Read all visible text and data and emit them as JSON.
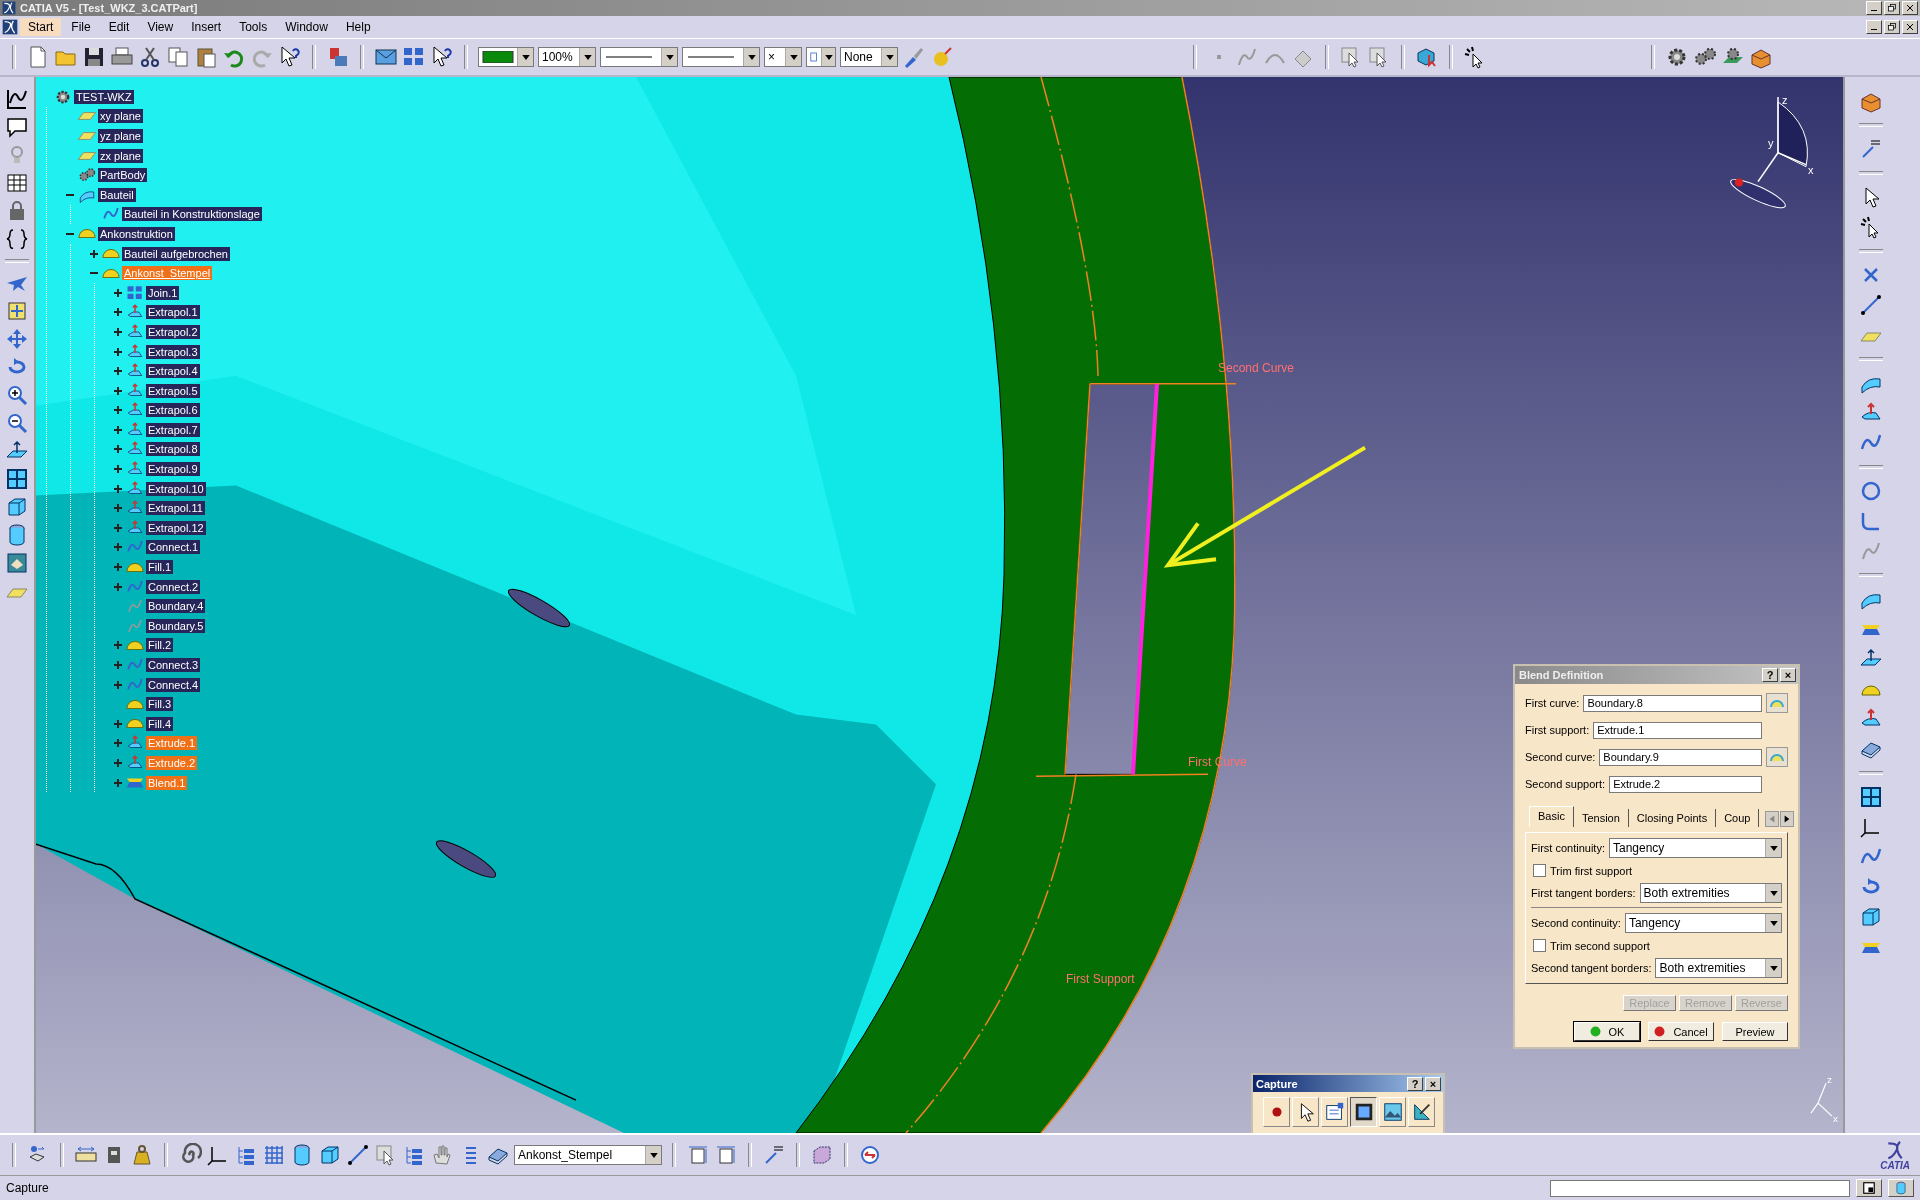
{
  "window": {
    "title": "CATIA V5 - [Test_WKZ_3.CATPart]"
  },
  "menu": [
    {
      "label": "Start",
      "selected": true
    },
    {
      "label": "File",
      "selected": false
    },
    {
      "label": "Edit",
      "selected": false
    },
    {
      "label": "View",
      "selected": false
    },
    {
      "label": "Insert",
      "selected": false
    },
    {
      "label": "Tools",
      "selected": false
    },
    {
      "label": "Window",
      "selected": false
    },
    {
      "label": "Help",
      "selected": false
    }
  ],
  "toolbar": {
    "zoom": "100%",
    "point_symbol": "×",
    "layer": "None"
  },
  "tree": {
    "nodes": [
      {
        "label": "TEST-WKZ",
        "kind": "part",
        "selected": false,
        "current": false,
        "children": [
          {
            "label": "xy plane",
            "kind": "plane",
            "selected": false,
            "current": false
          },
          {
            "label": "yz plane",
            "kind": "plane",
            "selected": false,
            "current": false
          },
          {
            "label": "zx plane",
            "kind": "plane",
            "selected": false,
            "current": false
          },
          {
            "label": "PartBody",
            "kind": "body",
            "selected": false,
            "current": false
          },
          {
            "label": "Bauteil",
            "kind": "geometric_set",
            "selected": false,
            "current": false,
            "expanded": true,
            "children": [
              {
                "label": "Bauteil in Konstruktionslage",
                "kind": "link",
                "selected": false,
                "current": false
              }
            ]
          },
          {
            "label": "Ankonstruktion",
            "kind": "ordered_set",
            "selected": false,
            "current": false,
            "expanded": true,
            "children": [
              {
                "label": "Bauteil aufgebrochen",
                "kind": "ordered_set",
                "selected": false,
                "current": false,
                "expanded": false
              },
              {
                "label": "Ankonst_Stempel",
                "kind": "ordered_set",
                "selected": true,
                "current": true,
                "expanded": true,
                "children": [
                  {
                    "label": "Join.1",
                    "kind": "join",
                    "selected": false,
                    "current": false,
                    "expanded": false
                  },
                  {
                    "label": "Extrapol.1",
                    "kind": "extrapol",
                    "selected": false,
                    "current": false,
                    "expanded": false
                  },
                  {
                    "label": "Extrapol.2",
                    "kind": "extrapol",
                    "selected": false,
                    "current": false,
                    "expanded": false
                  },
                  {
                    "label": "Extrapol.3",
                    "kind": "extrapol",
                    "selected": false,
                    "current": false,
                    "expanded": false
                  },
                  {
                    "label": "Extrapol.4",
                    "kind": "extrapol",
                    "selected": false,
                    "current": false,
                    "expanded": false
                  },
                  {
                    "label": "Extrapol.5",
                    "kind": "extrapol",
                    "selected": false,
                    "current": false,
                    "expanded": false
                  },
                  {
                    "label": "Extrapol.6",
                    "kind": "extrapol",
                    "selected": false,
                    "current": false,
                    "expanded": false
                  },
                  {
                    "label": "Extrapol.7",
                    "kind": "extrapol",
                    "selected": false,
                    "current": false,
                    "expanded": false
                  },
                  {
                    "label": "Extrapol.8",
                    "kind": "extrapol",
                    "selected": false,
                    "current": false,
                    "expanded": false
                  },
                  {
                    "label": "Extrapol.9",
                    "kind": "extrapol",
                    "selected": false,
                    "current": false,
                    "expanded": false
                  },
                  {
                    "label": "Extrapol.10",
                    "kind": "extrapol",
                    "selected": false,
                    "current": false,
                    "expanded": false
                  },
                  {
                    "label": "Extrapol.11",
                    "kind": "extrapol",
                    "selected": false,
                    "current": false,
                    "expanded": false
                  },
                  {
                    "label": "Extrapol.12",
                    "kind": "extrapol",
                    "selected": false,
                    "current": false,
                    "expanded": false
                  },
                  {
                    "label": "Connect.1",
                    "kind": "connect",
                    "selected": false,
                    "current": false,
                    "expanded": false
                  },
                  {
                    "label": "Fill.1",
                    "kind": "fill",
                    "selected": false,
                    "current": false,
                    "expanded": false
                  },
                  {
                    "label": "Connect.2",
                    "kind": "connect",
                    "selected": false,
                    "current": false,
                    "expanded": false
                  },
                  {
                    "label": "Boundary.4",
                    "kind": "boundary",
                    "selected": false,
                    "current": false
                  },
                  {
                    "label": "Boundary.5",
                    "kind": "boundary",
                    "selected": false,
                    "current": false
                  },
                  {
                    "label": "Fill.2",
                    "kind": "fill",
                    "selected": false,
                    "current": false,
                    "expanded": false
                  },
                  {
                    "label": "Connect.3",
                    "kind": "connect",
                    "selected": false,
                    "current": false,
                    "expanded": false
                  },
                  {
                    "label": "Connect.4",
                    "kind": "connect",
                    "selected": false,
                    "current": false,
                    "expanded": false
                  },
                  {
                    "label": "Fill.3",
                    "kind": "fill",
                    "selected": false,
                    "current": false
                  },
                  {
                    "label": "Fill.4",
                    "kind": "fill",
                    "selected": false,
                    "current": false,
                    "expanded": false
                  },
                  {
                    "label": "Extrude.1",
                    "kind": "extrude",
                    "selected": true,
                    "current": false,
                    "expanded": false
                  },
                  {
                    "label": "Extrude.2",
                    "kind": "extrude",
                    "selected": true,
                    "current": false,
                    "expanded": false
                  },
                  {
                    "label": "Blend.1",
                    "kind": "blend",
                    "selected": true,
                    "current": false,
                    "expanded": false
                  }
                ]
              }
            ]
          }
        ]
      }
    ]
  },
  "viewport_labels": [
    {
      "text": "Second Curve"
    },
    {
      "text": "First Curve"
    },
    {
      "text": "First Support"
    }
  ],
  "compass": {
    "axes": [
      "z",
      "y",
      "x"
    ]
  },
  "axis_triad": {
    "axes": [
      "z",
      "x"
    ]
  },
  "dialog": {
    "title": "Blend Definition",
    "title_buttons": [
      "?",
      "×"
    ],
    "fields": [
      {
        "label": "First curve:",
        "value": "Boundary.8",
        "picker": true
      },
      {
        "label": "First support:",
        "value": "Extrude.1",
        "picker": false
      },
      {
        "label": "Second curve:",
        "value": "Boundary.9",
        "picker": true
      },
      {
        "label": "Second support:",
        "value": "Extrude.2",
        "picker": false
      }
    ],
    "tabs": [
      {
        "label": "Basic",
        "selected": true
      },
      {
        "label": "Tension",
        "selected": false
      },
      {
        "label": "Closing Points",
        "selected": false
      },
      {
        "label": "Coup",
        "selected": false
      }
    ],
    "option_groups": [
      [
        {
          "kind": "dropdown",
          "label": "First continuity:",
          "value": "Tangency"
        },
        {
          "kind": "checkbox",
          "label": "Trim first support",
          "checked": false
        },
        {
          "kind": "dropdown",
          "label": "First tangent borders:",
          "value": "Both extremities"
        }
      ],
      [
        {
          "kind": "dropdown",
          "label": "Second continuity:",
          "value": "Tangency"
        },
        {
          "kind": "checkbox",
          "label": "Trim second support",
          "checked": false
        },
        {
          "kind": "dropdown",
          "label": "Second tangent borders:",
          "value": "Both extremities"
        }
      ]
    ],
    "list_buttons": [
      {
        "label": "Replace",
        "disabled": true
      },
      {
        "label": "Remove",
        "disabled": true
      },
      {
        "label": "Reverse",
        "disabled": true
      }
    ],
    "buttons": [
      {
        "label": "OK",
        "kind": "ok"
      },
      {
        "label": "Cancel",
        "kind": "cancel"
      },
      {
        "label": "Preview",
        "kind": "plain"
      }
    ]
  },
  "capture_toolbar": {
    "title": "Capture",
    "title_buttons": [
      "?",
      "×"
    ],
    "tools": [
      {
        "selected": false
      },
      {
        "selected": false
      },
      {
        "selected": false
      },
      {
        "selected": true
      },
      {
        "selected": false
      },
      {
        "selected": false
      }
    ]
  },
  "bottom_toolbar": {
    "current_body": "Ankonst_Stempel"
  },
  "logo": {
    "text": "CATIA"
  },
  "status_bar": {
    "message": "Capture"
  }
}
